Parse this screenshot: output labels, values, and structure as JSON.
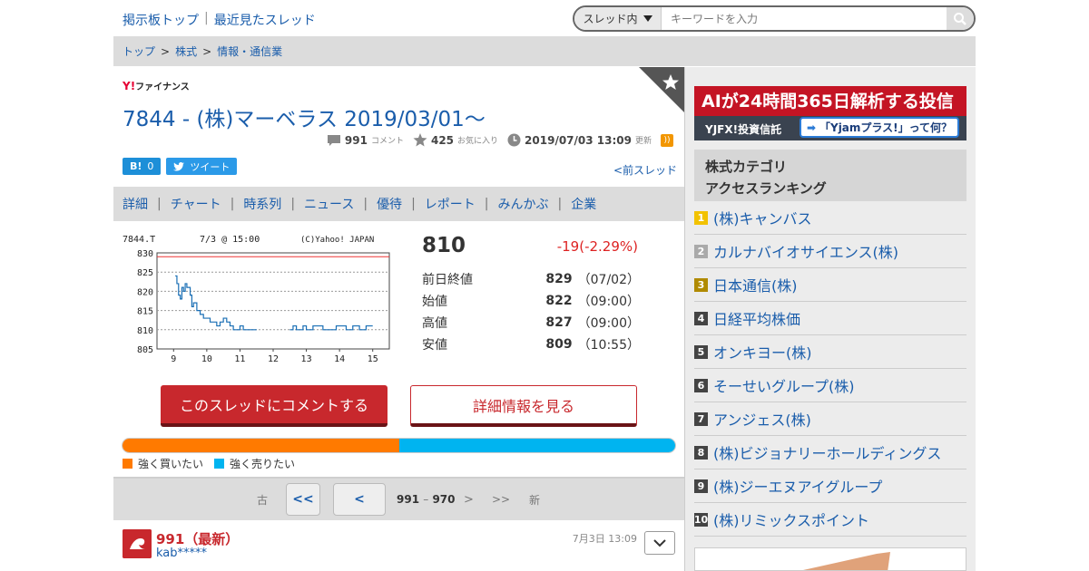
{
  "header": {
    "nav": [
      "掲示板トップ",
      "最近見たスレッド"
    ],
    "search_scope": "スレッド内",
    "search_placeholder": "キーワードを入力"
  },
  "breadcrumb": [
    "トップ",
    "株式",
    "情報・通信業"
  ],
  "brand": {
    "logo_mark": "Y!",
    "logo_text": "ファイナンス"
  },
  "thread": {
    "title": "7844 - (株)マーベラス 2019/03/01〜",
    "comments": "991",
    "comments_label": "コメント",
    "favorites": "425",
    "favorites_label": "お気に入り",
    "updated": "2019/07/03 13:09",
    "updated_label": "更新",
    "hatena_count": "0",
    "tweet_label": "ツイート",
    "prev_thread": "<前スレッド"
  },
  "subtabs": [
    "詳細",
    "チャート",
    "時系列",
    "ニュース",
    "優待",
    "レポート",
    "みんかぶ",
    "企業"
  ],
  "quote": {
    "price": "810",
    "change": "-19(-2.29%)",
    "rows": [
      {
        "label": "前日終値",
        "value": "829",
        "time": "（07/02）"
      },
      {
        "label": "始値",
        "value": "822",
        "time": "（09:00）"
      },
      {
        "label": "高値",
        "value": "827",
        "time": "（09:00）"
      },
      {
        "label": "安値",
        "value": "809",
        "time": "（10:55）"
      }
    ]
  },
  "actions": {
    "comment": "このスレッドにコメントする",
    "detail": "詳細情報を見る"
  },
  "sentiment": {
    "buy_ratio": 0.5,
    "buy_label": "強く買いたい",
    "sell_label": "強く売りたい",
    "buy_color": "#ff7a00",
    "sell_color": "#00b4f0"
  },
  "pager": {
    "oldest": "古",
    "first": "<<",
    "prev": "<",
    "range_start": "991",
    "range_dash": "–",
    "range_end": "970",
    "next": ">",
    "last": ">>",
    "newest": "新"
  },
  "comment": {
    "number": "991（最新）",
    "user": "kab*****",
    "date": "7月3日 13:09"
  },
  "sidebar": {
    "ad_line1": "AIが24時間365日解析する投信",
    "ad_line2": "YJFX!投資信託",
    "ad_pill": "「Yjamプラス!」って何？",
    "ranking_title": [
      "株式カテゴリ",
      "アクセスランキング"
    ],
    "ranking": [
      {
        "rank": "1",
        "name": "(株)キャンバス",
        "color": "#f2c200"
      },
      {
        "rank": "2",
        "name": "カルナバイオサイエンス(株)",
        "color": "#aaaaaa"
      },
      {
        "rank": "3",
        "name": "日本通信(株)",
        "color": "#b08a00"
      },
      {
        "rank": "4",
        "name": "日経平均株価",
        "color": "#444444"
      },
      {
        "rank": "5",
        "name": "オンキヨー(株)",
        "color": "#444444"
      },
      {
        "rank": "6",
        "name": "そーせいグループ(株)",
        "color": "#444444"
      },
      {
        "rank": "7",
        "name": "アンジェス(株)",
        "color": "#444444"
      },
      {
        "rank": "8",
        "name": "(株)ビジョナリーホールディングス",
        "color": "#444444"
      },
      {
        "rank": "9",
        "name": "(株)ジーエヌアイグループ",
        "color": "#444444"
      },
      {
        "rank": "10",
        "name": "(株)リミックスポイント",
        "color": "#444444"
      }
    ]
  },
  "chart_data": {
    "type": "line",
    "header_left": "7844.T",
    "header_mid": "7/3 @ 15:00",
    "header_right": "(C)Yahoo! JAPAN",
    "ylim": [
      805,
      830
    ],
    "yticks": [
      "830",
      "825",
      "820",
      "815",
      "810",
      "805"
    ],
    "xticks": [
      "9",
      "10",
      "11",
      "12",
      "13",
      "14",
      "15"
    ],
    "xlim": [
      8.5,
      15.5
    ],
    "prev_close": 829,
    "series": [
      {
        "points": [
          [
            9.05,
            824
          ],
          [
            9.1,
            822
          ],
          [
            9.15,
            819
          ],
          [
            9.2,
            818
          ],
          [
            9.25,
            821
          ],
          [
            9.3,
            820
          ],
          [
            9.35,
            822
          ],
          [
            9.4,
            821
          ],
          [
            9.45,
            821
          ],
          [
            9.5,
            819
          ],
          [
            9.55,
            816
          ],
          [
            9.6,
            817
          ],
          [
            9.7,
            815
          ],
          [
            9.8,
            814
          ],
          [
            9.9,
            813
          ],
          [
            10.0,
            813
          ],
          [
            10.1,
            812
          ],
          [
            10.2,
            812
          ],
          [
            10.3,
            811
          ],
          [
            10.4,
            812
          ],
          [
            10.5,
            813
          ],
          [
            10.6,
            812
          ],
          [
            10.7,
            811
          ],
          [
            10.8,
            810
          ],
          [
            10.9,
            810
          ],
          [
            11.0,
            811
          ],
          [
            11.1,
            810
          ],
          [
            11.2,
            810
          ],
          [
            11.3,
            810
          ],
          [
            11.4,
            810
          ],
          [
            11.5,
            810
          ]
        ]
      },
      {
        "points": [
          [
            12.5,
            810
          ],
          [
            12.6,
            811
          ],
          [
            12.7,
            810
          ],
          [
            12.8,
            810
          ],
          [
            12.9,
            811
          ],
          [
            13.0,
            810
          ],
          [
            13.1,
            810
          ],
          [
            13.2,
            811
          ],
          [
            13.3,
            811
          ],
          [
            13.5,
            810
          ],
          [
            13.7,
            810
          ],
          [
            13.9,
            811
          ],
          [
            14.0,
            811
          ],
          [
            14.2,
            810
          ],
          [
            14.4,
            811
          ],
          [
            14.6,
            810
          ],
          [
            14.8,
            811
          ],
          [
            15.0,
            811
          ]
        ]
      }
    ]
  }
}
